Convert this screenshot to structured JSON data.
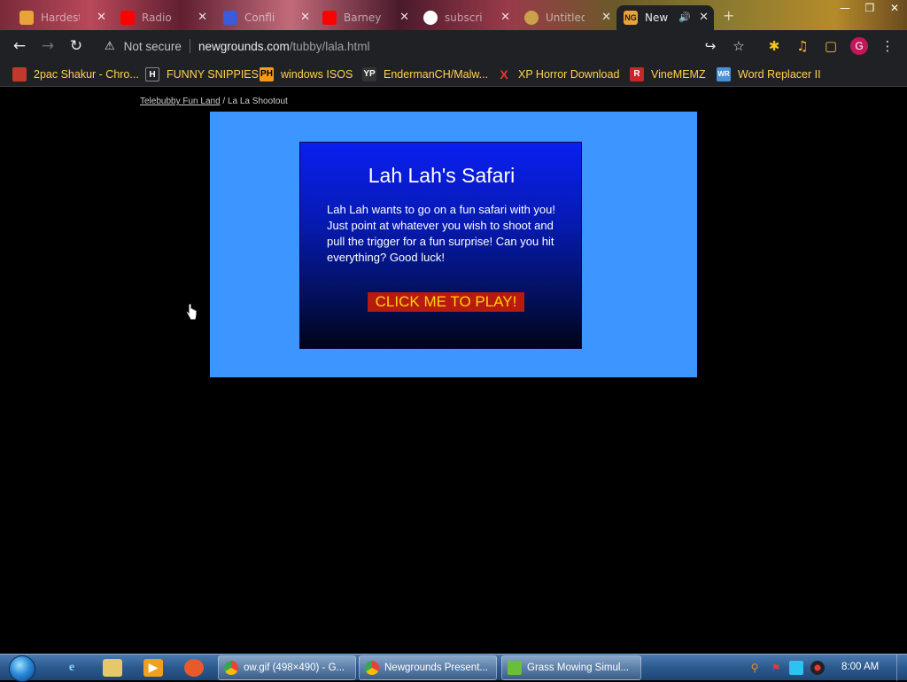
{
  "browser": {
    "tabs": [
      {
        "title": "Hardest",
        "favicon_color": "#e8a33a"
      },
      {
        "title": "Radio",
        "favicon_color": "#ff0000"
      },
      {
        "title": "Confli",
        "favicon_color": "#3b5bdb"
      },
      {
        "title": "Barney",
        "favicon_color": "#ff0000"
      },
      {
        "title": "subscri",
        "favicon_color": "#ffffff"
      },
      {
        "title": "Untitled",
        "favicon_color": "#caa24a"
      },
      {
        "title": "New",
        "favicon_color": "#e8a33a",
        "active": true
      }
    ],
    "active_tab_badge": "NG",
    "new_tab": "+",
    "window_controls": [
      "—",
      "❒",
      "✕"
    ],
    "nav": {
      "back": "←",
      "forward": "→",
      "reload": "↻"
    },
    "security_icon": "⚠",
    "security_text": "Not secure",
    "url_host": "newgrounds.com",
    "url_path": "/tubby/lala.html",
    "toolbar_icons": {
      "share": "↪",
      "star": "☆",
      "extensions": "✱",
      "media": "♫",
      "sidebar": "▢",
      "menu": "⋮"
    },
    "profile_initial": "G"
  },
  "bookmarks": [
    {
      "label": "2pac Shakur - Chro...",
      "icon_text": "",
      "icon_color": "#c0392b"
    },
    {
      "label": "FUNNY SNIPPIES",
      "icon_text": "H",
      "icon_color": "#202124"
    },
    {
      "label": "windows ISOS",
      "icon_text": "PH",
      "icon_color": "#f7971d"
    },
    {
      "label": "EndermanCH/Malw...",
      "icon_text": "YP",
      "icon_color": "#333333"
    },
    {
      "label": "XP Horror Download",
      "icon_text": "X",
      "icon_color": "#202124"
    },
    {
      "label": "VineMEMZ",
      "icon_text": "R",
      "icon_color": "#c62828"
    },
    {
      "label": "Word Replacer II",
      "icon_text": "WR",
      "icon_color": "#4a90d9"
    }
  ],
  "page": {
    "breadcrumb_link": "Telebubby Fun Land",
    "breadcrumb_sep": " / ",
    "breadcrumb_current": "La La Shootout",
    "game_title": "Lah Lah's Safari",
    "game_description": "Lah Lah wants to go on a fun safari with you! Just point at whatever you wish to shoot and pull the trigger for a fun surprise! Can you hit everything? Good luck!",
    "play_button": "CLICK ME TO PLAY!",
    "frame_color": "#3d96ff",
    "button_color": "#b71a10",
    "button_text_color": "#ffd400"
  },
  "taskbar": {
    "tasks": [
      {
        "label": "ow.gif (498×490) - G..."
      },
      {
        "label": "Newgrounds Present..."
      },
      {
        "label": "Grass Mowing Simul..."
      }
    ],
    "clock": "8:00 AM"
  }
}
